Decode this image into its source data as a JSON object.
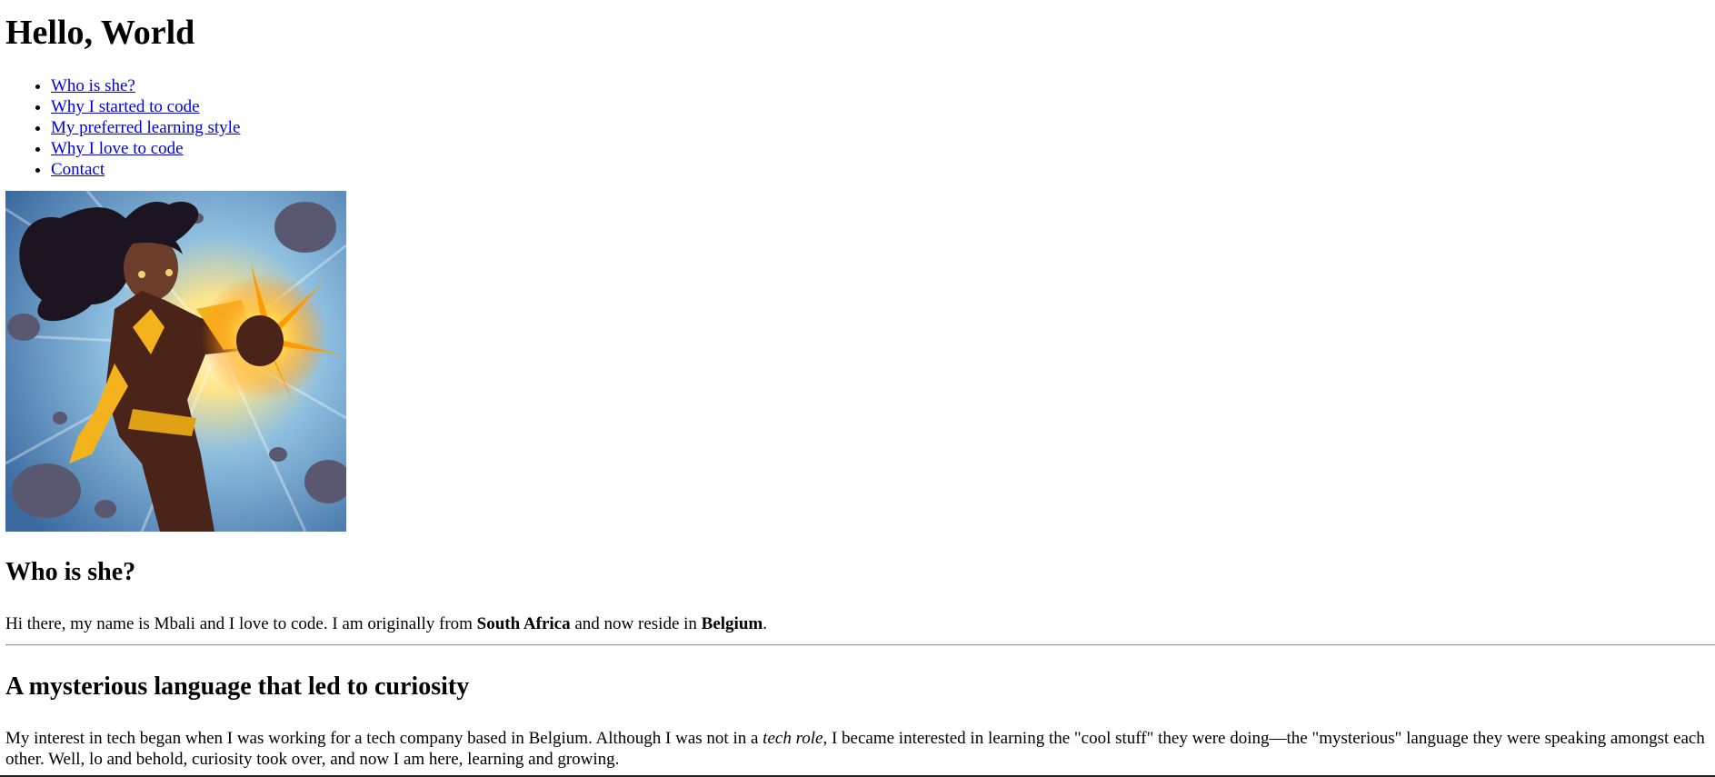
{
  "page": {
    "title": "Hello, World"
  },
  "nav": {
    "items": [
      {
        "label": "Who is she?"
      },
      {
        "label": "Why I started to code"
      },
      {
        "label": "My preferred learning style"
      },
      {
        "label": "Why I love to code"
      },
      {
        "label": "Contact"
      }
    ]
  },
  "hero_image": {
    "alt": "Superhero illustration"
  },
  "who": {
    "heading": "Who is she?",
    "text_before": "Hi there, my name is Mbali and I love to code. I am originally from ",
    "country_from": "South Africa",
    "text_middle": " and now reside in ",
    "country_now": "Belgium",
    "text_end": "."
  },
  "mysterious": {
    "heading": "A mysterious language that led to curiosity",
    "text_before": "My interest in tech began when I was working for a tech company based in Belgium. Although I was not in a ",
    "emphasis": "tech role",
    "text_after": ", I became interested in learning the \"cool stuff\" they were doing—the \"mysterious\" language they were speaking amongst each other. Well, lo and behold, curiosity took over, and now I am here, learning and growing."
  },
  "colors": {
    "link": "#0000ee",
    "text": "#000000",
    "background": "#ffffff"
  }
}
